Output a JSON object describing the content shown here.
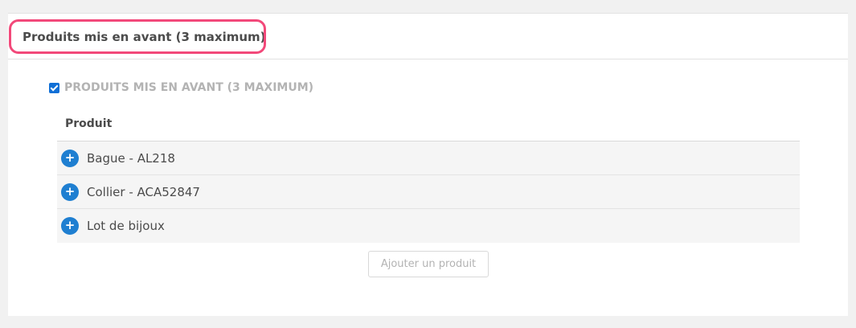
{
  "panel": {
    "title": "Produits mis en avant (3 maximum)"
  },
  "featured": {
    "checkbox_checked": true,
    "checkbox_label": "PRODUITS MIS EN AVANT (3 MAXIMUM)"
  },
  "table": {
    "column_header": "Produit",
    "rows": [
      {
        "label": "Bague - AL218",
        "icon": "plus-icon"
      },
      {
        "label": "Collier - ACA52847",
        "icon": "plus-icon"
      },
      {
        "label": "Lot de bijoux",
        "icon": "plus-icon"
      }
    ]
  },
  "add_button": {
    "label": "Ajouter un produit"
  },
  "colors": {
    "highlight": "#f2497a",
    "accent": "#1f7fd1",
    "checkbox": "#0f6fd6"
  }
}
